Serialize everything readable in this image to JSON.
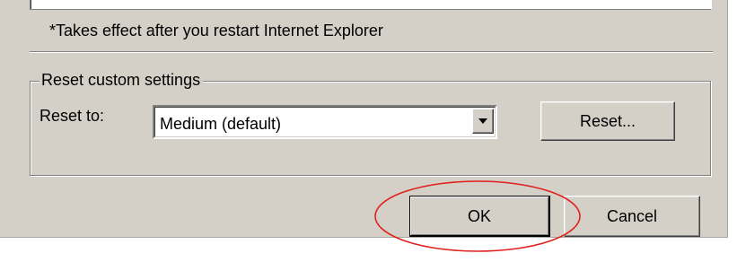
{
  "dialog": {
    "restart_note": "*Takes effect after you restart Internet Explorer",
    "reset_group": {
      "title": "Reset custom settings",
      "reset_to_label": "Reset to:",
      "reset_to_value": "Medium (default)",
      "reset_button_label": "Reset..."
    },
    "buttons": {
      "ok_label": "OK",
      "cancel_label": "Cancel"
    }
  },
  "annotation": {
    "highlight_color": "#e0201c",
    "highlighted_element": "ok-button"
  },
  "colors": {
    "dialog_background": "#d4d0c8",
    "field_background": "#ffffff"
  },
  "icons": {
    "combo_dropdown": "chevron-down-icon"
  }
}
